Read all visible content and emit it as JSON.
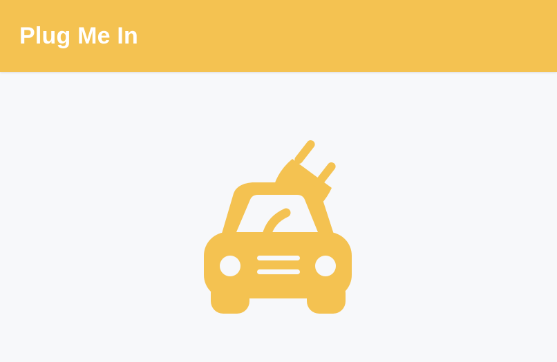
{
  "app": {
    "title": "Plug Me In"
  },
  "hero": {
    "icon": "car-plug-icon"
  },
  "colors": {
    "accent": "#f4c251",
    "background": "#f7f8fa",
    "title_text": "#ffffff"
  }
}
